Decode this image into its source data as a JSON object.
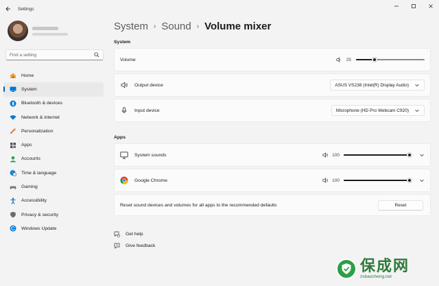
{
  "window": {
    "title": "Settings"
  },
  "sidebar": {
    "search_placeholder": "Find a setting",
    "items": [
      {
        "label": "Home",
        "icon": "home-icon",
        "active": false
      },
      {
        "label": "System",
        "icon": "system-icon",
        "active": true
      },
      {
        "label": "Bluetooth & devices",
        "icon": "bluetooth-icon",
        "active": false
      },
      {
        "label": "Network & internet",
        "icon": "wifi-icon",
        "active": false
      },
      {
        "label": "Personalization",
        "icon": "brush-icon",
        "active": false
      },
      {
        "label": "Apps",
        "icon": "apps-icon",
        "active": false
      },
      {
        "label": "Accounts",
        "icon": "account-icon",
        "active": false
      },
      {
        "label": "Time & language",
        "icon": "globe-clock-icon",
        "active": false
      },
      {
        "label": "Gaming",
        "icon": "gamepad-icon",
        "active": false
      },
      {
        "label": "Accessibility",
        "icon": "accessibility-icon",
        "active": false
      },
      {
        "label": "Privacy & security",
        "icon": "shield-icon",
        "active": false
      },
      {
        "label": "Windows Update",
        "icon": "update-icon",
        "active": false
      }
    ]
  },
  "breadcrumb": {
    "level1": "System",
    "level2": "Sound",
    "current": "Volume mixer",
    "separator": "›"
  },
  "system_section": {
    "heading": "System",
    "volume": {
      "label": "Volume",
      "value": 25
    },
    "output": {
      "label": "Output device",
      "selected": "ASUS VS238 (Intel(R) Display Audio)"
    },
    "input": {
      "label": "Input device",
      "selected": "Microphone (HD Pro Webcam C920)"
    }
  },
  "apps_section": {
    "heading": "Apps",
    "apps": [
      {
        "name": "System sounds",
        "icon": "monitor-icon",
        "volume": 100
      },
      {
        "name": "Google Chrome",
        "icon": "chrome-icon",
        "volume": 100
      }
    ],
    "reset": {
      "text": "Reset sound devices and volumes for all apps to the recommended defaults",
      "button": "Reset"
    }
  },
  "links": {
    "help": "Get help",
    "feedback": "Give feedback"
  },
  "watermark": {
    "big": "保成网",
    "small": "zsbaocheng.net"
  },
  "colors": {
    "accent": "#005fb8",
    "background": "#f3f3f3",
    "card": "#fbfbfb"
  }
}
